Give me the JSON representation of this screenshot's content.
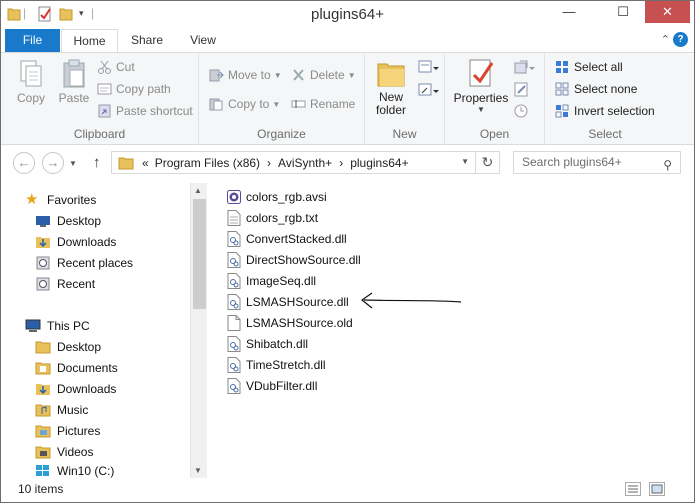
{
  "window": {
    "title": "plugins64+"
  },
  "titlebar": {
    "minimize": "—",
    "maximize": "☐",
    "close": "✕"
  },
  "tabs": {
    "file": "File",
    "home": "Home",
    "share": "Share",
    "view": "View",
    "collapse": "⌃",
    "help": "?"
  },
  "ribbon": {
    "clipboard": {
      "label": "Clipboard",
      "copy": "Copy",
      "paste": "Paste",
      "cut": "Cut",
      "copy_path": "Copy path",
      "paste_shortcut": "Paste shortcut"
    },
    "organize": {
      "label": "Organize",
      "move_to": "Move to",
      "copy_to": "Copy to",
      "delete": "Delete",
      "rename": "Rename"
    },
    "new": {
      "label": "New",
      "new_folder": "New folder"
    },
    "open": {
      "label": "Open",
      "properties": "Properties"
    },
    "select": {
      "label": "Select",
      "select_all": "Select all",
      "select_none": "Select none",
      "invert_selection": "Invert selection"
    }
  },
  "address": {
    "prefix": "«",
    "crumbs": [
      "Program Files (x86)",
      "AviSynth+",
      "plugins64+"
    ],
    "separator": "›",
    "search_placeholder": "Search plugins64+"
  },
  "navpane": {
    "favorites": {
      "label": "Favorites",
      "items": [
        "Desktop",
        "Downloads",
        "Recent places",
        "Recent"
      ]
    },
    "this_pc": {
      "label": "This PC",
      "items": [
        "Desktop",
        "Documents",
        "Downloads",
        "Music",
        "Pictures",
        "Videos",
        "Win10 (C:)"
      ]
    }
  },
  "files": [
    {
      "name": "colors_rgb.avsi",
      "type": "avsi"
    },
    {
      "name": "colors_rgb.txt",
      "type": "txt"
    },
    {
      "name": "ConvertStacked.dll",
      "type": "dll"
    },
    {
      "name": "DirectShowSource.dll",
      "type": "dll"
    },
    {
      "name": "ImageSeq.dll",
      "type": "dll"
    },
    {
      "name": "LSMASHSource.dll",
      "type": "dll"
    },
    {
      "name": "LSMASHSource.old",
      "type": "blank"
    },
    {
      "name": "Shibatch.dll",
      "type": "dll"
    },
    {
      "name": "TimeStretch.dll",
      "type": "dll"
    },
    {
      "name": "VDubFilter.dll",
      "type": "dll"
    }
  ],
  "status": {
    "count": "10 items"
  },
  "colors": {
    "accent": "#1979ca",
    "close": "#c75050",
    "ribbon_bg": "#f5f6f7",
    "folder": "#e8c15a"
  }
}
